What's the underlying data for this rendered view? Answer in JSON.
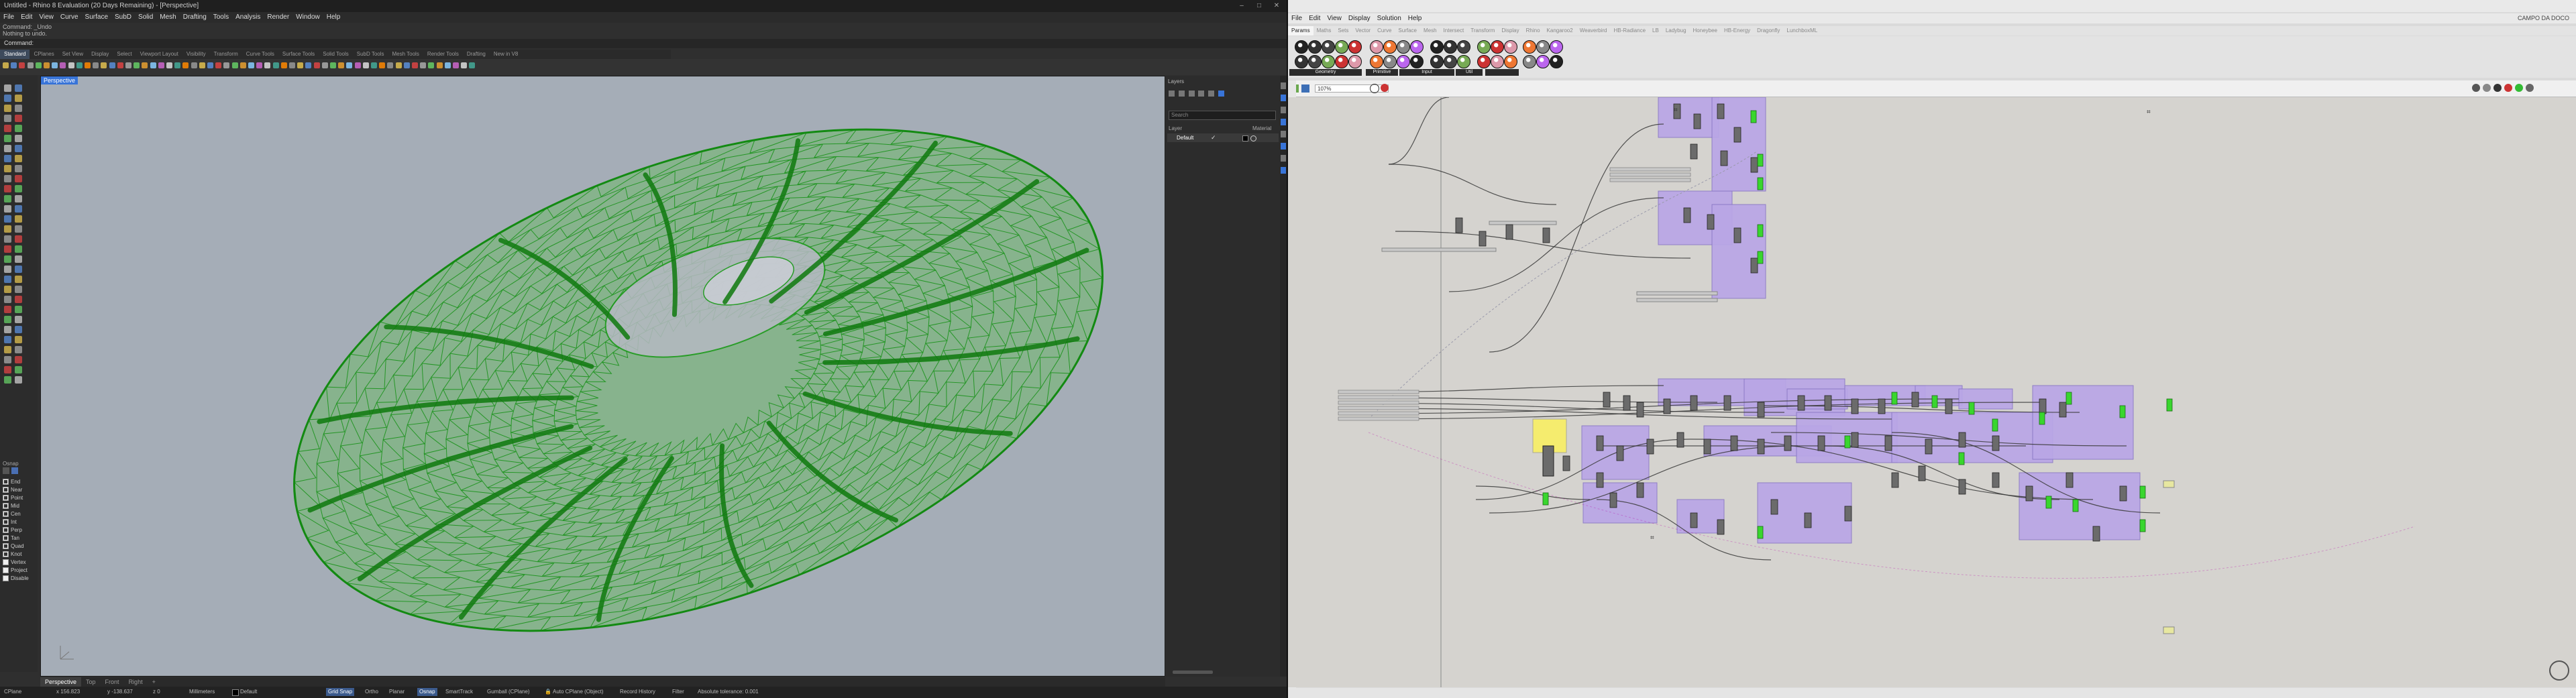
{
  "rhino": {
    "title": "Untitled - Rhino 8 Evaluation (20 Days Remaining) - [Perspective]",
    "menu": [
      "File",
      "Edit",
      "View",
      "Curve",
      "Surface",
      "SubD",
      "Solid",
      "Mesh",
      "Drafting",
      "Tools",
      "Analysis",
      "Render",
      "Window",
      "Help"
    ],
    "command_history": [
      "Command: _Undo",
      "Nothing to undo."
    ],
    "command_prompt": "Command:",
    "toolbar_tabs": [
      "Standard",
      "CPlanes",
      "Set View",
      "Display",
      "Select",
      "Viewport Layout",
      "Visibility",
      "Transform",
      "Curve Tools",
      "Surface Tools",
      "Solid Tools",
      "SubD Tools",
      "Mesh Tools",
      "Render Tools",
      "Drafting",
      "New in V8"
    ],
    "active_tab": "Standard",
    "viewport_label": "Perspective",
    "panels_title": "Layers",
    "layer_header_name": "Layer",
    "layer_header_material": "Material",
    "search_placeholder": "Search",
    "layer_name": "Default",
    "osnap_title": "Osnap",
    "osnap_items": [
      {
        "label": "End",
        "checked": true
      },
      {
        "label": "Near",
        "checked": true
      },
      {
        "label": "Point",
        "checked": true
      },
      {
        "label": "Mid",
        "checked": true
      },
      {
        "label": "Cen",
        "checked": true
      },
      {
        "label": "Int",
        "checked": true
      },
      {
        "label": "Perp",
        "checked": true
      },
      {
        "label": "Tan",
        "checked": true
      },
      {
        "label": "Quad",
        "checked": true
      },
      {
        "label": "Knot",
        "checked": true
      },
      {
        "label": "Vertex",
        "checked": false
      },
      {
        "label": "Project",
        "checked": false
      },
      {
        "label": "Disable",
        "checked": false
      }
    ],
    "view_tabs": [
      "Perspective",
      "Top",
      "Front",
      "Right"
    ],
    "active_view_tab": "Perspective",
    "status": {
      "cplane": "CPlane",
      "x": "x 156.823",
      "y": "y -138.637",
      "z": "z 0",
      "units": "Millimeters",
      "layer": "Default",
      "grid_snap": "Grid Snap",
      "ortho": "Ortho",
      "planar": "Planar",
      "osnap": "Osnap",
      "smarttrack": "SmartTrack",
      "gumball": "Gumball (CPlane)",
      "autocplane": "Auto CPlane (Object)",
      "record_history": "Record History",
      "filter": "Filter",
      "tolerance": "Absolute tolerance: 0.001"
    }
  },
  "grasshopper": {
    "menu": [
      "File",
      "Edit",
      "View",
      "Display",
      "Solution",
      "Help"
    ],
    "tabs": [
      "Params",
      "Maths",
      "Sets",
      "Vector",
      "Curve",
      "Surface",
      "Mesh",
      "Intersect",
      "Transform",
      "Display",
      "Rhino",
      "Kangaroo2",
      "Weaverbird",
      "HB-Radiance",
      "LB",
      "Ladybug",
      "Honeybee",
      "HB-Energy",
      "Dragonfly",
      "LunchboxML"
    ],
    "active_tab": "Params",
    "file_name": "CAMPO DA DOCO",
    "zoom": "107%",
    "component_groups": [
      "Geometry",
      "Primitive",
      "Input",
      "Util"
    ],
    "colors": {
      "group_fill": "#b9a6e6",
      "group_border": "#8a78c4",
      "canvas": "#d5d3cf",
      "component": "#6b6b6b",
      "green": "#39d62e",
      "panel_yellow": "#f5ec6e"
    }
  },
  "colors": {
    "viewport_bg": "#a5adb7",
    "mesh_green": "#1ea51b",
    "accent_blue": "#3874d8"
  }
}
